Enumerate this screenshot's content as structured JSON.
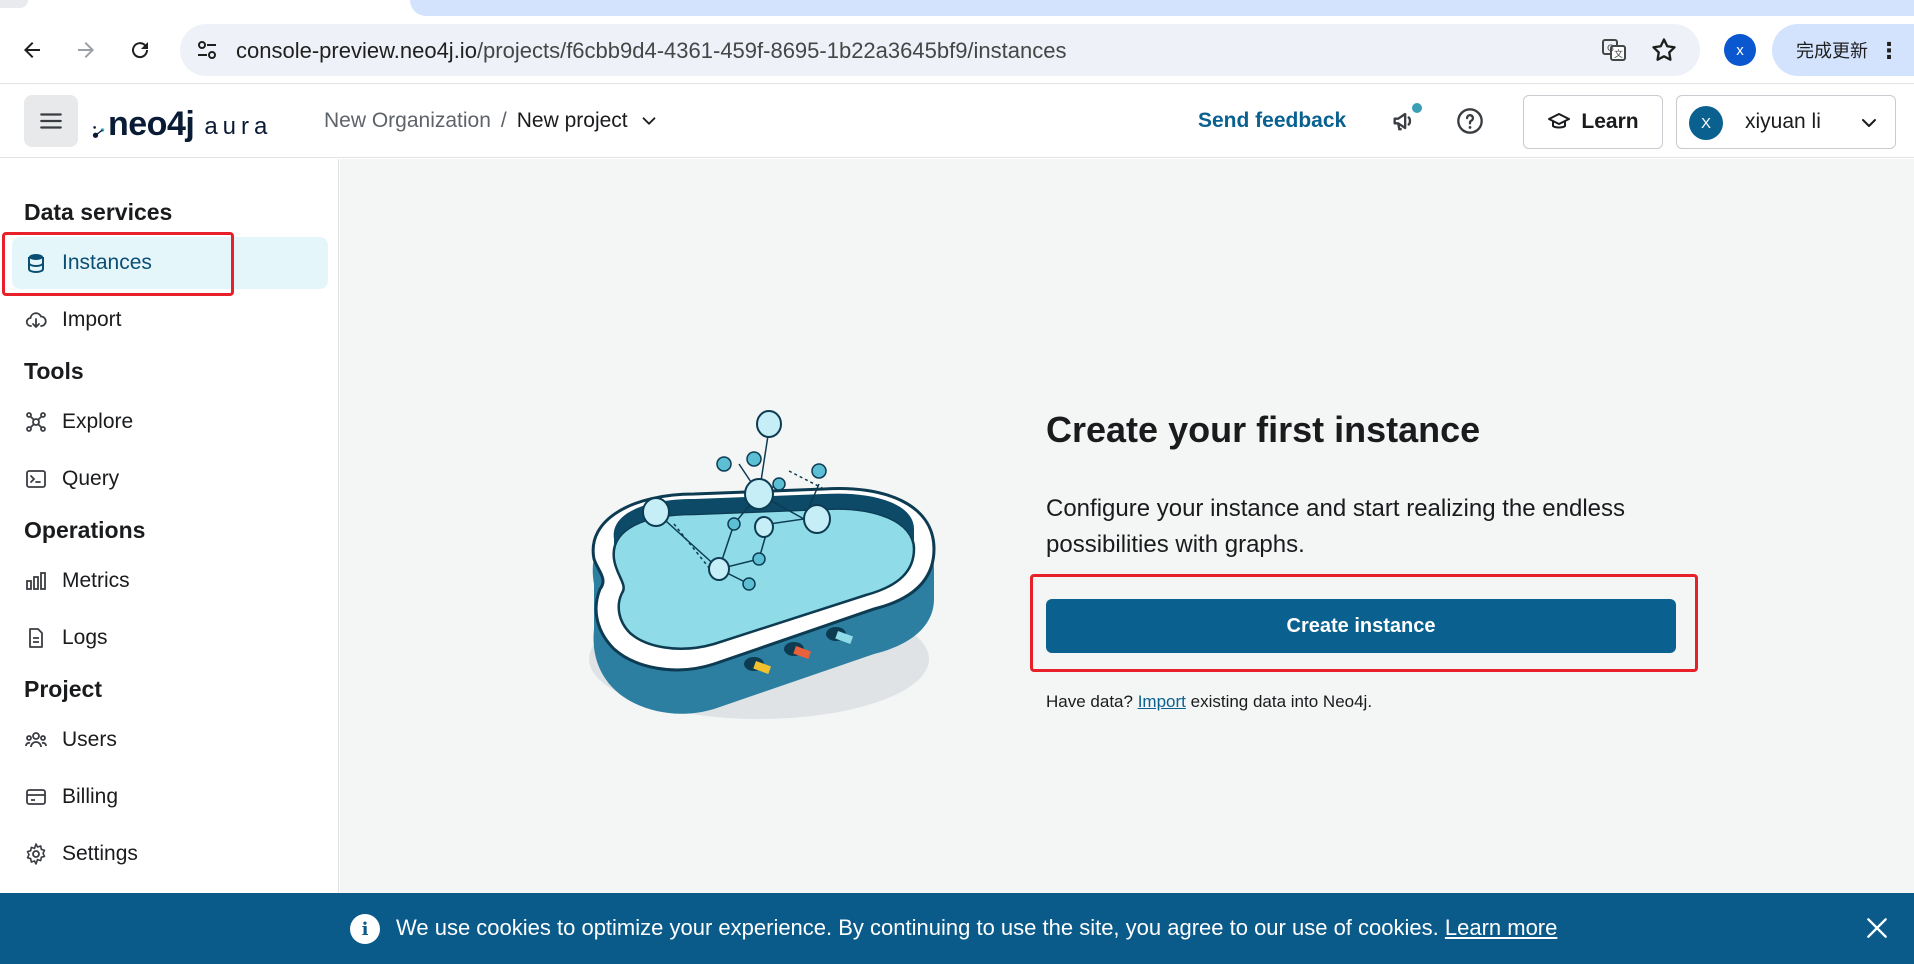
{
  "browser": {
    "url_host": "console-preview.neo4j.io",
    "url_path": "/projects/f6cbb9d4-4361-459f-8695-1b22a3645bf9/instances",
    "profile_initial": "x",
    "update_label": "完成更新"
  },
  "header": {
    "logo_neo": "neo4j",
    "logo_aura": "aura",
    "organization": "New Organization",
    "separator": "/",
    "project": "New project",
    "send_feedback": "Send feedback",
    "learn_label": "Learn",
    "user_initial": "X",
    "user_name": "xiyuan li"
  },
  "sidebar": {
    "sections": [
      {
        "heading": "Data services",
        "items": [
          {
            "label": "Instances",
            "icon": "database-icon"
          },
          {
            "label": "Import",
            "icon": "cloud-download-icon"
          }
        ]
      },
      {
        "heading": "Tools",
        "items": [
          {
            "label": "Explore",
            "icon": "graph-icon"
          },
          {
            "label": "Query",
            "icon": "terminal-icon"
          }
        ]
      },
      {
        "heading": "Operations",
        "items": [
          {
            "label": "Metrics",
            "icon": "bar-chart-icon"
          },
          {
            "label": "Logs",
            "icon": "document-icon"
          }
        ]
      },
      {
        "heading": "Project",
        "items": [
          {
            "label": "Users",
            "icon": "users-icon"
          },
          {
            "label": "Billing",
            "icon": "credit-card-icon"
          },
          {
            "label": "Settings",
            "icon": "gear-icon"
          }
        ]
      }
    ],
    "active_item": "Instances"
  },
  "main": {
    "title": "Create your first instance",
    "description": "Configure your instance and start realizing the endless possibilities with graphs.",
    "create_button": "Create instance",
    "import_prefix": "Have data?",
    "import_link": "Import",
    "import_suffix": "existing data into Neo4j."
  },
  "cookie_banner": {
    "info_glyph": "i",
    "message": "We use cookies to optimize your experience. By continuing to use the site, you agree to our use of cookies.",
    "learn_more": "Learn more"
  },
  "colors": {
    "primary": "#0a6190",
    "highlight": "#e8202a",
    "active_bg": "#e5f6fa",
    "cookie_bg": "#0a5a8a"
  }
}
